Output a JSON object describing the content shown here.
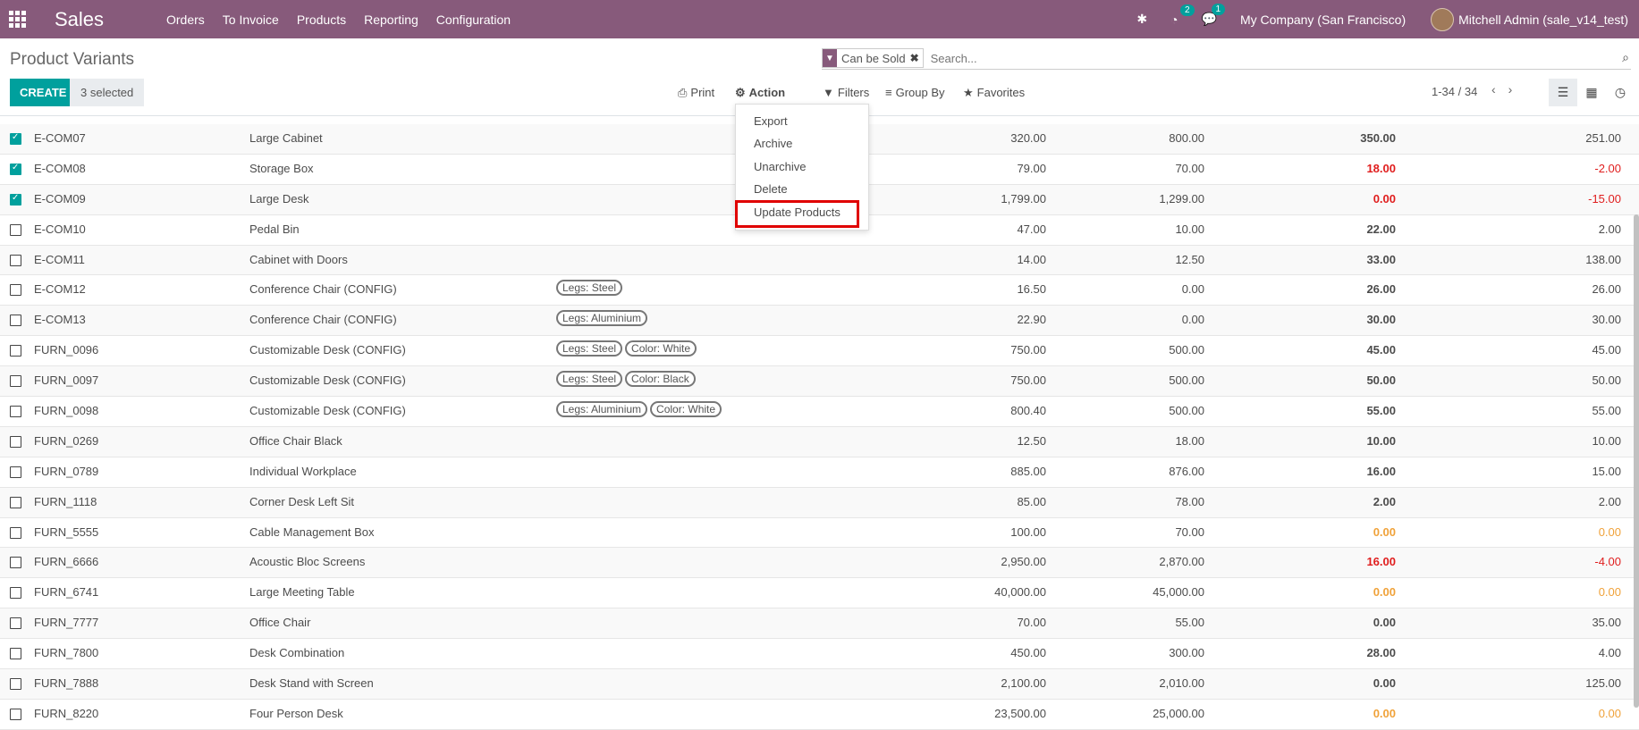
{
  "app": {
    "name": "Sales"
  },
  "topmenu": [
    "Orders",
    "To Invoice",
    "Products",
    "Reporting",
    "Configuration"
  ],
  "topbar": {
    "activity_count": "2",
    "messages_count": "1",
    "company": "My Company (San Francisco)",
    "user": "Mitchell Admin (sale_v14_test)"
  },
  "page": {
    "title": "Product Variants"
  },
  "search": {
    "facet": "Can be Sold",
    "placeholder": "Search..."
  },
  "buttons": {
    "create": "CREATE",
    "selected": "3 selected",
    "print": "Print",
    "action": "Action",
    "filters": "Filters",
    "groupby": "Group By",
    "favorites": "Favorites"
  },
  "pager": {
    "text": "1-34 / 34"
  },
  "action_menu": [
    "Export",
    "Archive",
    "Unarchive",
    "Delete",
    "Update Products"
  ],
  "rows": [
    {
      "ref": "E-COM07",
      "name": "Large Cabinet",
      "attrs": [],
      "c1": "320.00",
      "c2": "800.00",
      "c3": "350.00",
      "c4": "251.00",
      "checked": true,
      "c3s": "",
      "c4s": ""
    },
    {
      "ref": "E-COM08",
      "name": "Storage Box",
      "attrs": [],
      "c1": "79.00",
      "c2": "70.00",
      "c3": "18.00",
      "c4": "-2.00",
      "checked": true,
      "c3s": "neg",
      "c4s": "neg"
    },
    {
      "ref": "E-COM09",
      "name": "Large Desk",
      "attrs": [],
      "c1": "1,799.00",
      "c2": "1,299.00",
      "c3": "0.00",
      "c4": "-15.00",
      "checked": true,
      "c3s": "neg",
      "c4s": "neg"
    },
    {
      "ref": "E-COM10",
      "name": "Pedal Bin",
      "attrs": [],
      "c1": "47.00",
      "c2": "10.00",
      "c3": "22.00",
      "c4": "2.00",
      "checked": false,
      "c3s": "",
      "c4s": ""
    },
    {
      "ref": "E-COM11",
      "name": "Cabinet with Doors",
      "attrs": [],
      "c1": "14.00",
      "c2": "12.50",
      "c3": "33.00",
      "c4": "138.00",
      "checked": false,
      "c3s": "",
      "c4s": ""
    },
    {
      "ref": "E-COM12",
      "name": "Conference Chair (CONFIG)",
      "attrs": [
        "Legs: Steel"
      ],
      "c1": "16.50",
      "c2": "0.00",
      "c3": "26.00",
      "c4": "26.00",
      "checked": false,
      "c3s": "",
      "c4s": ""
    },
    {
      "ref": "E-COM13",
      "name": "Conference Chair (CONFIG)",
      "attrs": [
        "Legs: Aluminium"
      ],
      "c1": "22.90",
      "c2": "0.00",
      "c3": "30.00",
      "c4": "30.00",
      "checked": false,
      "c3s": "",
      "c4s": ""
    },
    {
      "ref": "FURN_0096",
      "name": "Customizable Desk (CONFIG)",
      "attrs": [
        "Legs: Steel",
        "Color: White"
      ],
      "c1": "750.00",
      "c2": "500.00",
      "c3": "45.00",
      "c4": "45.00",
      "checked": false,
      "c3s": "",
      "c4s": ""
    },
    {
      "ref": "FURN_0097",
      "name": "Customizable Desk (CONFIG)",
      "attrs": [
        "Legs: Steel",
        "Color: Black"
      ],
      "c1": "750.00",
      "c2": "500.00",
      "c3": "50.00",
      "c4": "50.00",
      "checked": false,
      "c3s": "",
      "c4s": ""
    },
    {
      "ref": "FURN_0098",
      "name": "Customizable Desk (CONFIG)",
      "attrs": [
        "Legs: Aluminium",
        "Color: White"
      ],
      "c1": "800.40",
      "c2": "500.00",
      "c3": "55.00",
      "c4": "55.00",
      "checked": false,
      "c3s": "",
      "c4s": ""
    },
    {
      "ref": "FURN_0269",
      "name": "Office Chair Black",
      "attrs": [],
      "c1": "12.50",
      "c2": "18.00",
      "c3": "10.00",
      "c4": "10.00",
      "checked": false,
      "c3s": "",
      "c4s": ""
    },
    {
      "ref": "FURN_0789",
      "name": "Individual Workplace",
      "attrs": [],
      "c1": "885.00",
      "c2": "876.00",
      "c3": "16.00",
      "c4": "15.00",
      "checked": false,
      "c3s": "",
      "c4s": ""
    },
    {
      "ref": "FURN_1118",
      "name": "Corner Desk Left Sit",
      "attrs": [],
      "c1": "85.00",
      "c2": "78.00",
      "c3": "2.00",
      "c4": "2.00",
      "checked": false,
      "c3s": "",
      "c4s": ""
    },
    {
      "ref": "FURN_5555",
      "name": "Cable Management Box",
      "attrs": [],
      "c1": "100.00",
      "c2": "70.00",
      "c3": "0.00",
      "c4": "0.00",
      "checked": false,
      "c3s": "warn",
      "c4s": "warn"
    },
    {
      "ref": "FURN_6666",
      "name": "Acoustic Bloc Screens",
      "attrs": [],
      "c1": "2,950.00",
      "c2": "2,870.00",
      "c3": "16.00",
      "c4": "-4.00",
      "checked": false,
      "c3s": "neg",
      "c4s": "neg"
    },
    {
      "ref": "FURN_6741",
      "name": "Large Meeting Table",
      "attrs": [],
      "c1": "40,000.00",
      "c2": "45,000.00",
      "c3": "0.00",
      "c4": "0.00",
      "checked": false,
      "c3s": "warn",
      "c4s": "warn"
    },
    {
      "ref": "FURN_7777",
      "name": "Office Chair",
      "attrs": [],
      "c1": "70.00",
      "c2": "55.00",
      "c3": "0.00",
      "c4": "35.00",
      "checked": false,
      "c3s": "",
      "c4s": ""
    },
    {
      "ref": "FURN_7800",
      "name": "Desk Combination",
      "attrs": [],
      "c1": "450.00",
      "c2": "300.00",
      "c3": "28.00",
      "c4": "4.00",
      "checked": false,
      "c3s": "",
      "c4s": ""
    },
    {
      "ref": "FURN_7888",
      "name": "Desk Stand with Screen",
      "attrs": [],
      "c1": "2,100.00",
      "c2": "2,010.00",
      "c3": "0.00",
      "c4": "125.00",
      "checked": false,
      "c3s": "",
      "c4s": ""
    },
    {
      "ref": "FURN_8220",
      "name": "Four Person Desk",
      "attrs": [],
      "c1": "23,500.00",
      "c2": "25,000.00",
      "c3": "0.00",
      "c4": "0.00",
      "checked": false,
      "c3s": "warn",
      "c4s": "warn"
    }
  ]
}
